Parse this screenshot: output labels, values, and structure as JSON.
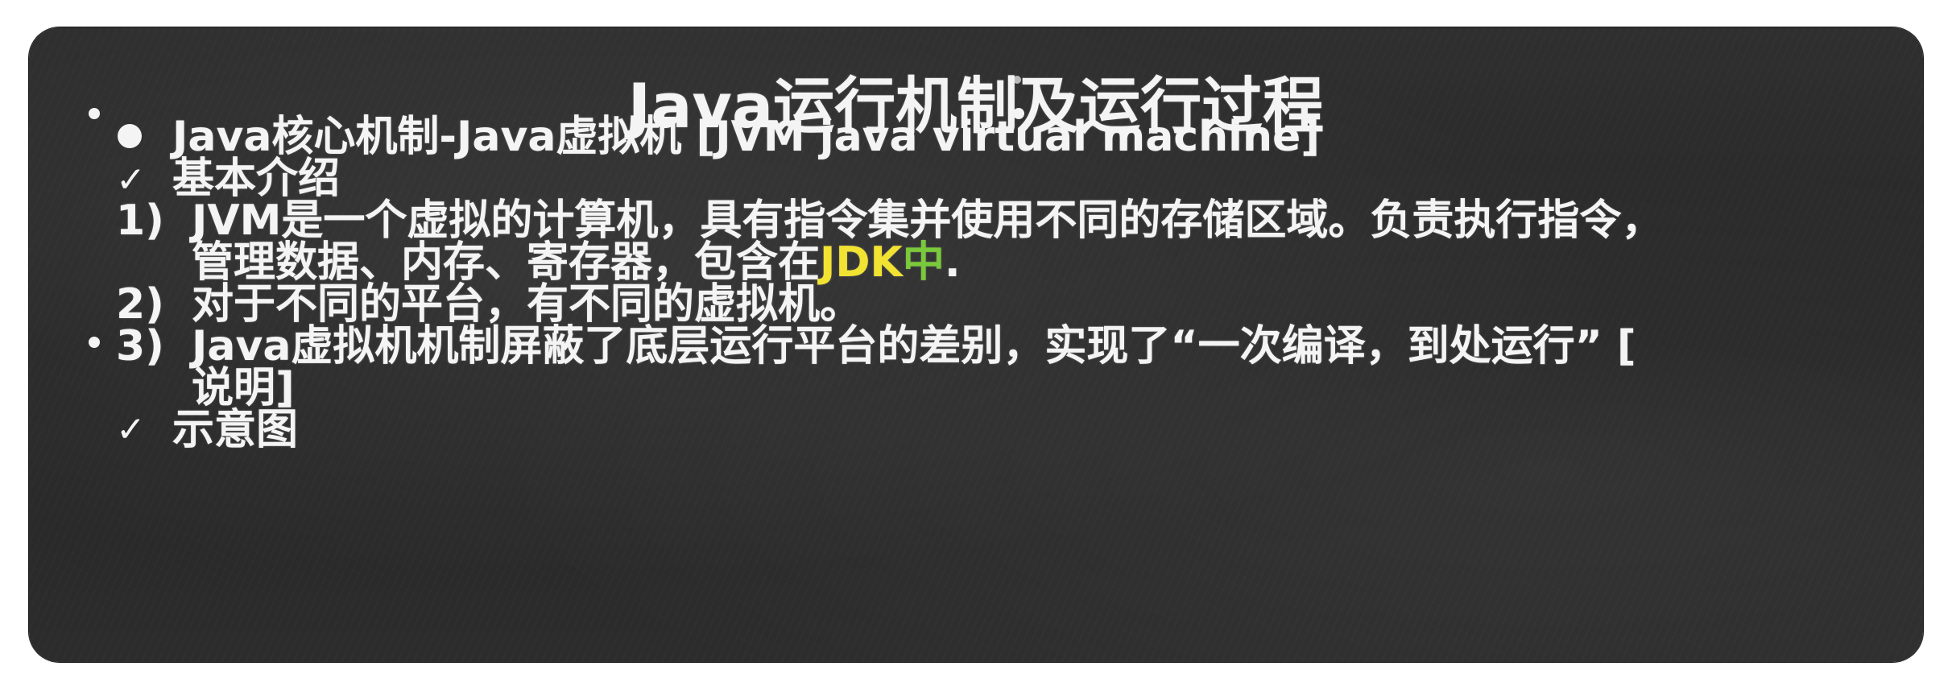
{
  "slide": {
    "title": "Java运行机制及运行过程",
    "heading": "Java核心机制-Java虚拟机 [JVM java virtual machine]",
    "sub_heading": "基本介绍",
    "items": [
      {
        "num": "1)",
        "line1": "JVM是一个虚拟的计算机，具有指令集并使用不同的存储区域。负责执行指令，",
        "line2_prefix": "管理数据、内存、寄存器，包含在",
        "line2_highlight_jdk": "JDK",
        "line2_highlight_zh": "中",
        "line2_suffix": "."
      },
      {
        "num": "2)",
        "line1": "对于不同的平台，有不同的虚拟机。"
      },
      {
        "num": "3)",
        "line1": "Java虚拟机机制屏蔽了底层运行平台的差别，实现了“一次编译，到处运行” [",
        "line2": "说明]"
      }
    ],
    "footer_heading": "示意图",
    "check_mark": "✓",
    "colors": {
      "background": "#2a2a2a",
      "text": "#f4f4f4",
      "highlight_jdk": "#f2e232",
      "highlight_zh": "#7ac93a"
    },
    "icons": [
      "bullet-dot-icon",
      "check-mark-icon"
    ]
  }
}
